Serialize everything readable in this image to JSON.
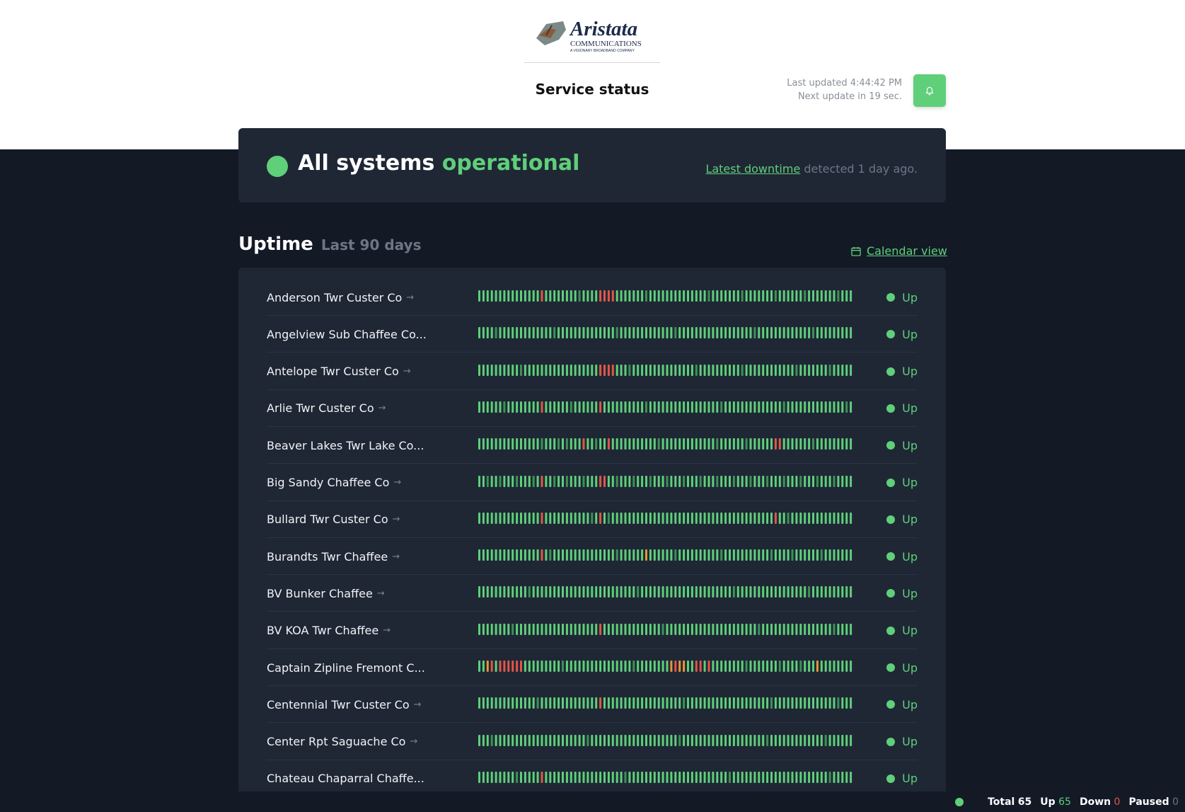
{
  "header": {
    "logo_text": "Aristata",
    "logo_subtext": "COMMUNICATIONS",
    "logo_tagline": "A VISIONARY BROADBAND COMPANY",
    "page_title": "Service status",
    "last_updated": "Last updated 4:44:42 PM",
    "next_update": "Next update in 19 sec."
  },
  "status": {
    "headline_white": "All systems",
    "headline_green": "operational",
    "downtime_link": "Latest downtime",
    "downtime_text": "detected 1 day ago."
  },
  "uptime": {
    "title": "Uptime",
    "range": "Last 90 days",
    "calendar_link": "Calendar view"
  },
  "colors": {
    "up": "#5fcf7a",
    "up_dim": "#3f8f5a",
    "down": "#e0564a",
    "partial": "#e8943a",
    "panel": "#1f2735",
    "page_bg": "#131a26"
  },
  "monitors": [
    {
      "name": "Anderson Twr Custer Co",
      "arrow": "→",
      "status": "Up",
      "red_days": [
        15,
        29,
        30,
        31,
        32
      ],
      "orange_days": [],
      "dim_days": [
        24,
        40,
        55,
        63,
        71,
        78,
        86
      ]
    },
    {
      "name": "Angelview Sub Chaffee Co...",
      "arrow": "",
      "status": "Up",
      "red_days": [],
      "orange_days": [],
      "dim_days": [
        4,
        18,
        33,
        47,
        66,
        80
      ]
    },
    {
      "name": "Antelope Twr Custer Co",
      "arrow": "→",
      "status": "Up",
      "red_days": [
        29,
        30,
        31,
        32
      ],
      "orange_days": [],
      "dim_days": [
        10,
        36,
        52,
        63,
        76,
        84
      ]
    },
    {
      "name": "Arlie Twr Custer Co",
      "arrow": "→",
      "status": "Up",
      "red_days": [
        15,
        29
      ],
      "orange_days": [],
      "dim_days": [
        6,
        22,
        40,
        58,
        73,
        88
      ]
    },
    {
      "name": "Beaver Lakes Twr Lake Co...",
      "arrow": "",
      "status": "Up",
      "red_days": [
        25,
        31,
        71,
        72
      ],
      "orange_days": [],
      "dim_days": [
        15,
        19,
        21,
        28,
        43,
        57,
        64,
        80
      ]
    },
    {
      "name": "Big Sandy Chaffee Co",
      "arrow": "→",
      "status": "Up",
      "red_days": [
        15,
        29,
        30
      ],
      "orange_days": [],
      "dim_days": [
        2,
        5,
        9,
        13,
        18,
        21,
        25,
        33,
        37,
        41,
        45,
        49,
        53,
        57,
        61,
        65,
        69,
        73,
        77,
        81,
        85
      ]
    },
    {
      "name": "Bullard Twr Custer Co",
      "arrow": "→",
      "status": "Up",
      "red_days": [
        15,
        29,
        71
      ],
      "orange_days": [],
      "dim_days": [
        27,
        31,
        74
      ]
    },
    {
      "name": "Burandts Twr Chaffee",
      "arrow": "→",
      "status": "Up",
      "red_days": [
        15
      ],
      "orange_days": [
        40
      ],
      "dim_days": [
        17,
        33,
        47,
        58,
        70,
        75,
        82
      ]
    },
    {
      "name": "BV Bunker Chaffee",
      "arrow": "→",
      "status": "Up",
      "red_days": [],
      "orange_days": [],
      "dim_days": [
        12,
        38,
        61,
        79
      ]
    },
    {
      "name": "BV KOA Twr Chaffee",
      "arrow": "→",
      "status": "Up",
      "red_days": [
        29
      ],
      "orange_days": [],
      "dim_days": [
        8,
        44,
        67,
        85
      ]
    },
    {
      "name": "Captain Zipline Fremont C...",
      "arrow": "",
      "status": "Up",
      "red_days": [
        3,
        5,
        6,
        7,
        8,
        9,
        10,
        47,
        52,
        53,
        55
      ],
      "orange_days": [
        2,
        46,
        48,
        49,
        81
      ],
      "dim_days": [
        20,
        37,
        64,
        72,
        77
      ]
    },
    {
      "name": "Centennial Twr Custer Co",
      "arrow": "→",
      "status": "Up",
      "red_days": [
        29
      ],
      "orange_days": [],
      "dim_days": [
        14,
        49,
        70,
        86
      ]
    },
    {
      "name": "Center Rpt Saguache Co",
      "arrow": "→",
      "status": "Up",
      "red_days": [],
      "orange_days": [],
      "dim_days": [
        3,
        26,
        48,
        69,
        83
      ]
    },
    {
      "name": "Chateau Chaparral Chaffe...",
      "arrow": "",
      "status": "Up",
      "red_days": [
        15
      ],
      "orange_days": [],
      "dim_days": [
        9,
        35,
        60,
        84
      ]
    }
  ],
  "footer": {
    "total_label": "Total",
    "total_value": "65",
    "up_label": "Up",
    "up_value": "65",
    "down_label": "Down",
    "down_value": "0",
    "paused_label": "Paused",
    "paused_value": "0"
  }
}
